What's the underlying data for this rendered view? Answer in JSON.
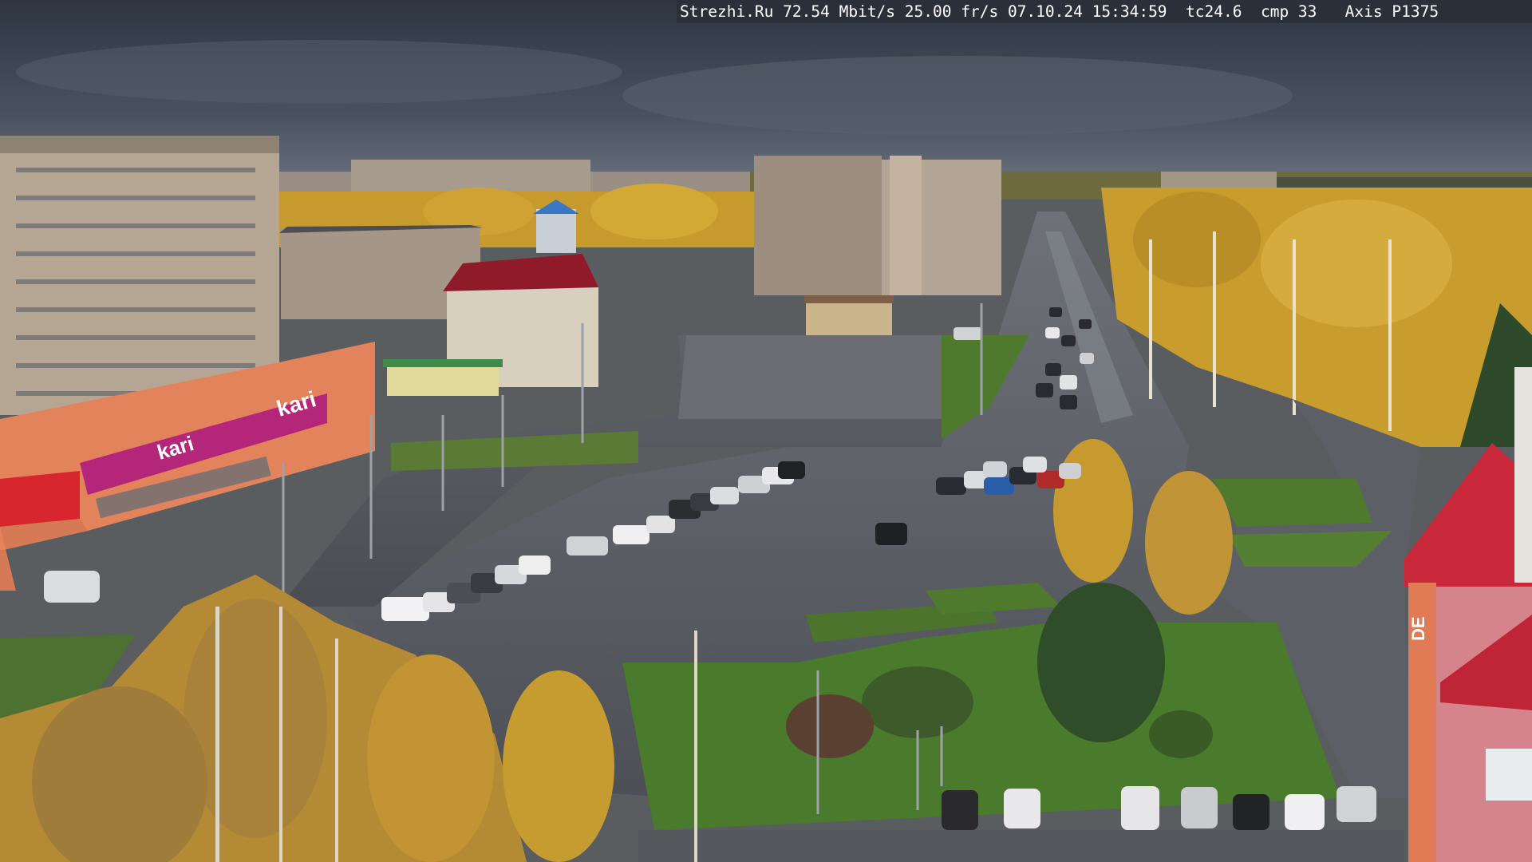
{
  "osd": {
    "site": "Strezhi.Ru",
    "bitrate": "72.54 Mbit/s",
    "framerate": "25.00 fr/s",
    "date": "07.10.24",
    "time": "15:34:59",
    "tc": "tc24.6",
    "cmp": "cmp 33",
    "camera": "Axis P1375"
  },
  "signage": {
    "store_brand": "kari",
    "store_banner": "kari",
    "side_brand": "DE"
  },
  "colors": {
    "sky": "#3d4552",
    "foliage": "#c9a233",
    "grass": "#4f7a2e",
    "asphalt": "#5a5d63",
    "store_magenta": "#b4267a",
    "store_red": "#d8262e"
  }
}
